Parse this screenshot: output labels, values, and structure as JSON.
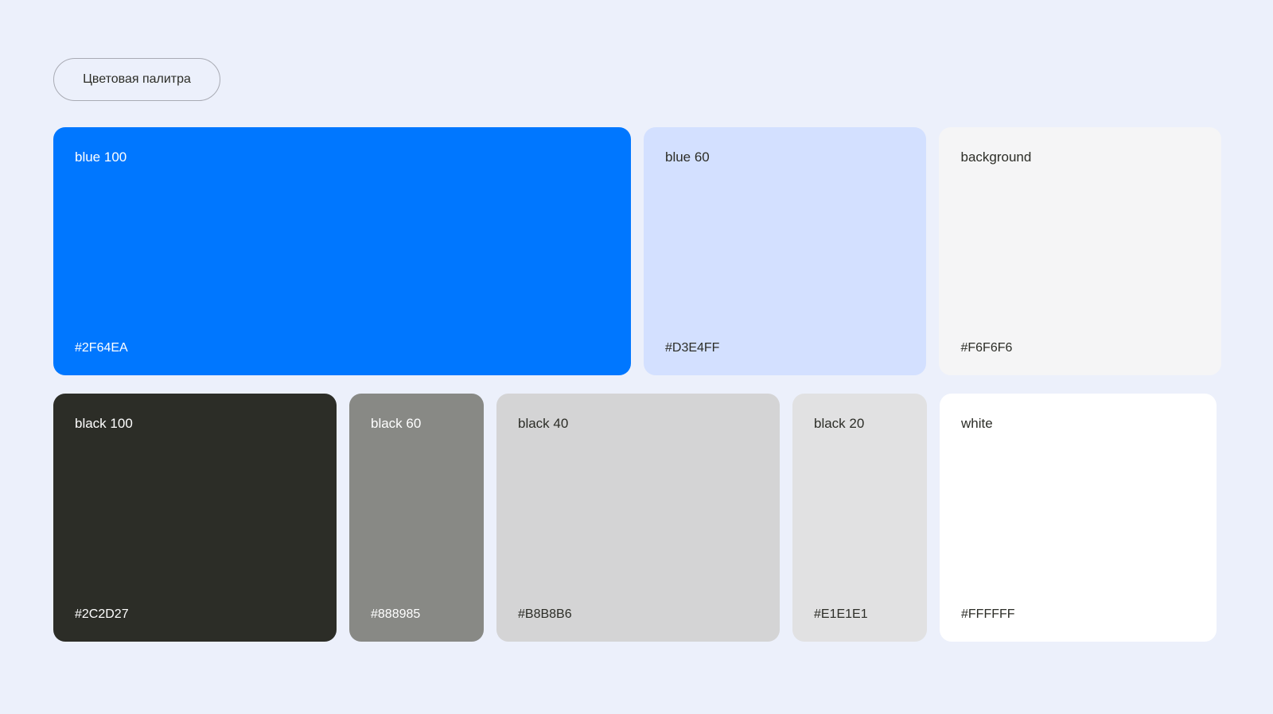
{
  "header": {
    "title": "Цветовая палитра"
  },
  "palette": {
    "rows": [
      {
        "swatches": [
          {
            "name": "blue 100",
            "hex": "#2F64EA",
            "color": "#0077FF",
            "text_color": "#FFFFFF"
          },
          {
            "name": "blue 60",
            "hex": "#D3E4FF",
            "color": "#D3E0FF",
            "text_color": "#2C2D27"
          },
          {
            "name": "background",
            "hex": "#F6F6F6",
            "color": "#F5F5F6",
            "text_color": "#2C2D27"
          }
        ]
      },
      {
        "swatches": [
          {
            "name": "black 100",
            "hex": "#2C2D27",
            "color": "#2C2D27",
            "text_color": "#FFFFFF"
          },
          {
            "name": "black 60",
            "hex": "#888985",
            "color": "#888985",
            "text_color": "#FFFFFF"
          },
          {
            "name": "black 40",
            "hex": "#B8B8B6",
            "color": "#D4D4D5",
            "text_color": "#2C2D27"
          },
          {
            "name": "black 20",
            "hex": "#E1E1E1",
            "color": "#E1E1E2",
            "text_color": "#2C2D27"
          },
          {
            "name": "white",
            "hex": "#FFFFFF",
            "color": "#FFFFFF",
            "text_color": "#2C2D27"
          }
        ]
      }
    ]
  }
}
